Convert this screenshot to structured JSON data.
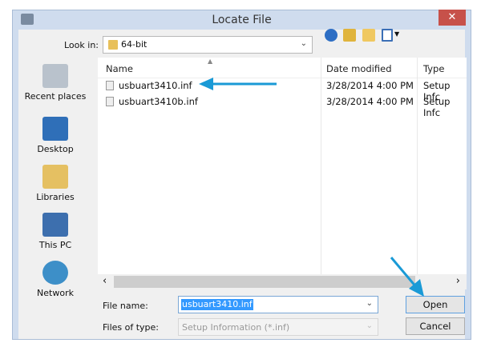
{
  "window": {
    "title": "Locate File",
    "close": "✕"
  },
  "look_in": {
    "label": "Look in:",
    "value": "64-bit"
  },
  "places": [
    {
      "label": "Recent places"
    },
    {
      "label": "Desktop"
    },
    {
      "label": "Libraries"
    },
    {
      "label": "This PC"
    },
    {
      "label": "Network"
    }
  ],
  "columns": {
    "name": "Name",
    "date": "Date modified",
    "type": "Type"
  },
  "files": [
    {
      "name": "usbuart3410.inf",
      "date": "3/28/2014 4:00 PM",
      "type": "Setup Infc"
    },
    {
      "name": "usbuart3410b.inf",
      "date": "3/28/2014 4:00 PM",
      "type": "Setup Infc"
    }
  ],
  "file_name": {
    "label": "File name:",
    "value": "usbuart3410.inf"
  },
  "file_type": {
    "label": "Files of type:",
    "value": "Setup Information (*.inf)"
  },
  "buttons": {
    "open": "Open",
    "cancel": "Cancel"
  },
  "scroll": {
    "left": "‹",
    "right": "›"
  },
  "colors": {
    "arrow": "#1a9ad6"
  }
}
